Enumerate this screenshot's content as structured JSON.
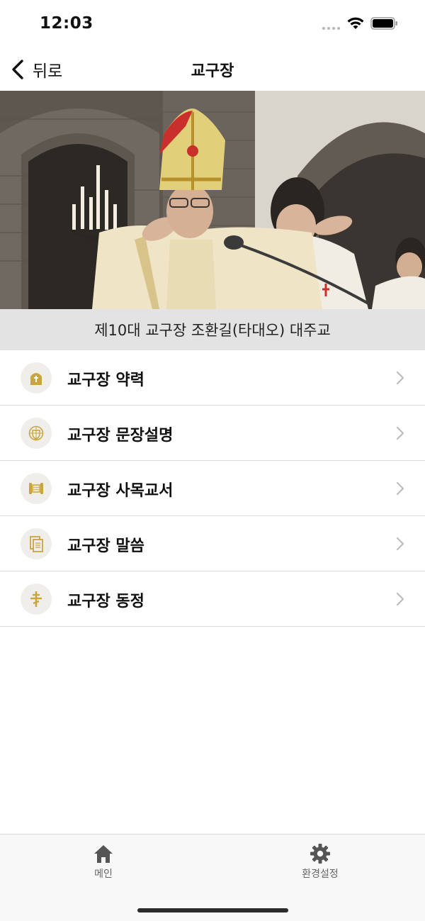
{
  "status_bar": {
    "time": "12:03"
  },
  "nav": {
    "back_label": "뒤로",
    "title": "교구장"
  },
  "hero": {
    "caption": "제10대 교구장 조환길(타대오) 대주교"
  },
  "menu": {
    "items": [
      {
        "label": "교구장 약력",
        "icon": "mitre-icon"
      },
      {
        "label": "교구장 문장설명",
        "icon": "coat-of-arms-icon"
      },
      {
        "label": "교구장 사목교서",
        "icon": "scroll-icon"
      },
      {
        "label": "교구장 말씀",
        "icon": "document-icon"
      },
      {
        "label": "교구장 동정",
        "icon": "archiepiscopal-cross-icon"
      }
    ]
  },
  "tab_bar": {
    "items": [
      {
        "label": "메인",
        "icon": "home-icon"
      },
      {
        "label": "환경설정",
        "icon": "gear-icon"
      }
    ]
  },
  "colors": {
    "accent_gold": "#c9a53a",
    "icon_circle": "#efeeea",
    "caption_bg": "#e3e3e3"
  }
}
